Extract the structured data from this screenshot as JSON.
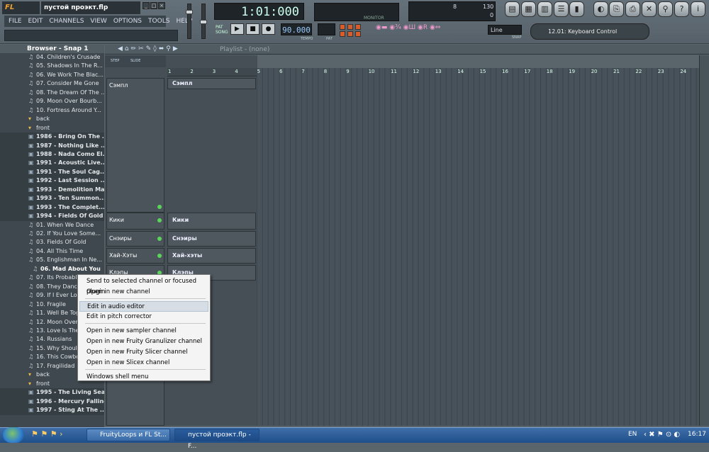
{
  "app": {
    "logo": "FL STUDIO",
    "project_title": "пустой проэкт.flp"
  },
  "menu": [
    "FILE",
    "EDIT",
    "CHANNELS",
    "VIEW",
    "OPTIONS",
    "TOOLS",
    "HELP"
  ],
  "transport": {
    "time": "1:01:000",
    "tempo": "90.000",
    "tempo_label": "TEMPO",
    "pat_label": "PAT",
    "snap_mode": "Line",
    "snap_label": "SNAP",
    "cpu_value": "130",
    "cpu_value2": "0",
    "cpu_small": "8",
    "monitor_label": "MONITOR",
    "plugin_hint": "12.01: Keyboard Control"
  },
  "browser": {
    "title": "Browser - Snap 1",
    "items": [
      {
        "text": "04. Children's Crusade",
        "kind": "file"
      },
      {
        "text": "05. Shadows In The R...",
        "kind": "file"
      },
      {
        "text": "06. We Work The Blac...",
        "kind": "file"
      },
      {
        "text": "07. Consider Me Gone",
        "kind": "file"
      },
      {
        "text": "08. The Dream Of The ...",
        "kind": "file"
      },
      {
        "text": "09. Moon Over Bourb...",
        "kind": "file"
      },
      {
        "text": "10. Fortress Around Y...",
        "kind": "file"
      },
      {
        "text": "back",
        "kind": "plain"
      },
      {
        "text": "front",
        "kind": "plain"
      },
      {
        "text": "1986 - Bring On The ...",
        "kind": "folder"
      },
      {
        "text": "1987 - Nothing Like ...",
        "kind": "folder"
      },
      {
        "text": "1988 - Nada Como El...",
        "kind": "folder"
      },
      {
        "text": "1991 - Acoustic Live...",
        "kind": "folder"
      },
      {
        "text": "1991 - The Soul Cag...",
        "kind": "folder"
      },
      {
        "text": "1992 - Last Session ...",
        "kind": "folder"
      },
      {
        "text": "1993 - Demolition Man",
        "kind": "folder"
      },
      {
        "text": "1993 - Ten Summon...",
        "kind": "folder"
      },
      {
        "text": "1993 - The Complet...",
        "kind": "folder"
      },
      {
        "text": "1994 - Fields Of Gold",
        "kind": "folder"
      },
      {
        "text": "01. When We Dance",
        "kind": "file"
      },
      {
        "text": "02. If You Love Some...",
        "kind": "file"
      },
      {
        "text": "03. Fields Of Gold",
        "kind": "file"
      },
      {
        "text": "04. All This Time",
        "kind": "file"
      },
      {
        "text": "05. Englishman In Ne...",
        "kind": "file"
      },
      {
        "text": "06. Mad About You",
        "kind": "sel"
      },
      {
        "text": "07. Its Probably Me",
        "kind": "file"
      },
      {
        "text": "08. They Dance Alone",
        "kind": "file"
      },
      {
        "text": "09. If I Ever Lose My ...",
        "kind": "file"
      },
      {
        "text": "10. Fragile",
        "kind": "file"
      },
      {
        "text": "11. Well Be Together",
        "kind": "file"
      },
      {
        "text": "12. Moon Over Bourb...",
        "kind": "file"
      },
      {
        "text": "13. Love Is The Seve...",
        "kind": "file"
      },
      {
        "text": "14. Russians",
        "kind": "file"
      },
      {
        "text": "15. Why Should I Cry...",
        "kind": "file"
      },
      {
        "text": "16. This Cowboy Song",
        "kind": "file"
      },
      {
        "text": "17. Fragilidad",
        "kind": "file"
      },
      {
        "text": "back",
        "kind": "plain"
      },
      {
        "text": "front",
        "kind": "plain"
      },
      {
        "text": "1995 - The Living Sea",
        "kind": "folder"
      },
      {
        "text": "1996 - Mercury Falling",
        "kind": "folder"
      },
      {
        "text": "1997 - Sting At The ...",
        "kind": "folder"
      }
    ]
  },
  "playlist": {
    "title": "Playlist - (none)",
    "step_label": "STEP",
    "slide_label": "SLIDE",
    "ruler": [
      "1",
      "2",
      "3",
      "4",
      "5",
      "6",
      "7",
      "8",
      "9",
      "10",
      "11",
      "12",
      "13",
      "14",
      "15",
      "16",
      "17",
      "18",
      "19",
      "20",
      "21",
      "22",
      "23",
      "24"
    ],
    "channels": [
      "Сэмпл",
      "Кики",
      "Снэиры",
      "Хай-Хэты",
      "Клэпы"
    ],
    "tracks": [
      "Сэмпл",
      "Кики",
      "Снэиры",
      "Хай-хэты",
      "Клэпы"
    ]
  },
  "context_menu": {
    "items": [
      "Send to selected channel or focused plugin",
      "Open in new channel",
      "Edit in audio editor",
      "Edit in pitch corrector",
      "Open in new sampler channel",
      "Open in new Fruity Granulizer channel",
      "Open in new Fruity Slicer channel",
      "Open in new Slicex channel",
      "Windows shell menu"
    ],
    "highlighted_index": 2
  },
  "taskbar": {
    "tasks": [
      "FruityLoops и FL St...",
      "пустой проэкт.flp - F..."
    ],
    "language": "EN",
    "clock": "16:17"
  },
  "colors": {
    "accent": "#f0a030",
    "menu_highlight": "#d6dde5",
    "channel_led": "#5ad55a"
  }
}
